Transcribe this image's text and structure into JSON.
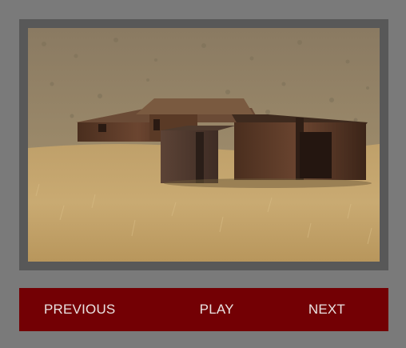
{
  "slideshow": {
    "image": {
      "description_icon": "photo-landscape-icon"
    },
    "controls": {
      "previous_label": "PREVIOUS",
      "play_label": "PLAY",
      "next_label": "NEXT"
    }
  },
  "colors": {
    "page_background": "#7a7a7a",
    "frame": "#585858",
    "control_bar": "#730004",
    "control_text": "#e9e2e2"
  }
}
